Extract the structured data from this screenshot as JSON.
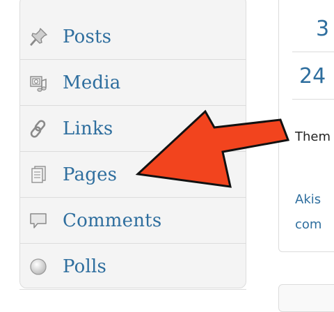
{
  "menu": {
    "items": [
      {
        "label": "Posts",
        "icon": "pushpin-icon"
      },
      {
        "label": "Media",
        "icon": "media-icon"
      },
      {
        "label": "Links",
        "icon": "chain-link-icon"
      },
      {
        "label": "Pages",
        "icon": "pages-icon"
      },
      {
        "label": "Comments",
        "icon": "speech-bubble-icon"
      },
      {
        "label": "Polls",
        "icon": "circle-icon"
      }
    ]
  },
  "right": {
    "stat_1": "3",
    "stat_2": "24",
    "text_1": "Them",
    "text_2": "Akis",
    "text_3": "com"
  },
  "annotation": {
    "arrow_color": "#f2441e",
    "arrow_outline_color": "#111111",
    "target": "Pages"
  },
  "colors": {
    "menu_text": "#2e6e9e",
    "menu_bg": "#f4f4f4",
    "border": "#dcdcdc"
  }
}
